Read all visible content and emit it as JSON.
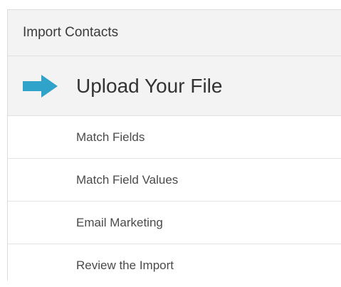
{
  "panel": {
    "title": "Import Contacts"
  },
  "steps": {
    "active": {
      "label": "Upload Your File",
      "icon": "arrow-right-icon",
      "icon_color": "#2fa3c9"
    },
    "items": [
      {
        "label": "Match Fields"
      },
      {
        "label": "Match Field Values"
      },
      {
        "label": "Email Marketing"
      },
      {
        "label": "Review the Import"
      }
    ]
  }
}
